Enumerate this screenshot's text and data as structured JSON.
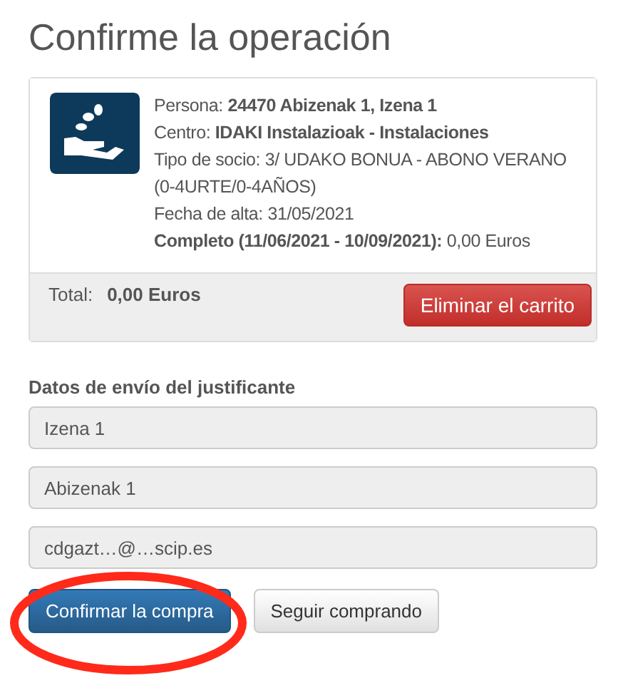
{
  "title": "Confirme la operación",
  "order": {
    "lines": [
      {
        "label": "Persona:",
        "value": "24470 Abizenak 1, Izena 1",
        "label_bold": false,
        "value_bold": true
      },
      {
        "label": "Centro:",
        "value": "IDAKI Instalazioak - Instalaciones",
        "label_bold": false,
        "value_bold": true
      },
      {
        "label": "Tipo de socio:",
        "value": "3/ UDAKO BONUA - ABONO VERANO (0-4URTE/0-4AÑOS)",
        "label_bold": false,
        "value_bold": false
      },
      {
        "label": "Fecha de alta:",
        "value": "31/05/2021",
        "label_bold": false,
        "value_bold": false
      },
      {
        "label": "Completo (11/06/2021 - 10/09/2021):",
        "value": "0,00 Euros",
        "label_bold": true,
        "value_bold": false
      }
    ],
    "total_label": "Total:",
    "total_value": "0,00 Euros",
    "remove_button": "Eliminar el carrito"
  },
  "shipping": {
    "heading": "Datos de envío del justificante",
    "fields": [
      {
        "value": "Izena 1"
      },
      {
        "value": "Abizenak 1"
      },
      {
        "value": "cdgazt…@…scip.es"
      }
    ]
  },
  "buttons": [
    {
      "label": "Confirmar la compra",
      "kind": "primary",
      "circled": true
    },
    {
      "label": "Seguir comprando",
      "kind": "default",
      "circled": false
    }
  ]
}
